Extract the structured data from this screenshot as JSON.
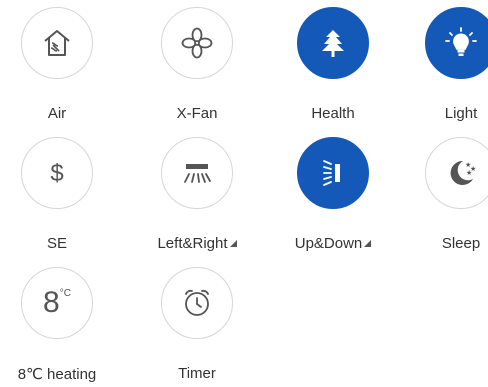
{
  "colors": {
    "active": "#1458b8",
    "inactive_icon": "#555555",
    "border": "#d6d6d6",
    "label": "#333333"
  },
  "tiles": [
    {
      "label": "Air",
      "icon": "air-house-icon",
      "active": false
    },
    {
      "label": "X-Fan",
      "icon": "fan-icon",
      "active": false
    },
    {
      "label": "Health",
      "icon": "tree-icon",
      "active": true
    },
    {
      "label": "Light",
      "icon": "light-bulb-icon",
      "active": true
    },
    {
      "label": "SE",
      "icon": "dollar-icon",
      "active": false
    },
    {
      "label": "Left&Right",
      "icon": "swing-left-right-icon",
      "active": false,
      "has_dropdown": true
    },
    {
      "label": "Up&Down",
      "icon": "swing-up-down-icon",
      "active": true,
      "has_dropdown": true
    },
    {
      "label": "Sleep",
      "icon": "moon-stars-icon",
      "active": false
    },
    {
      "label": "8℃ heating",
      "icon": "eight-degree-icon",
      "icon_text": "8",
      "icon_unit": "°C",
      "active": false
    },
    {
      "label": "Timer",
      "icon": "alarm-clock-icon",
      "active": false
    }
  ]
}
